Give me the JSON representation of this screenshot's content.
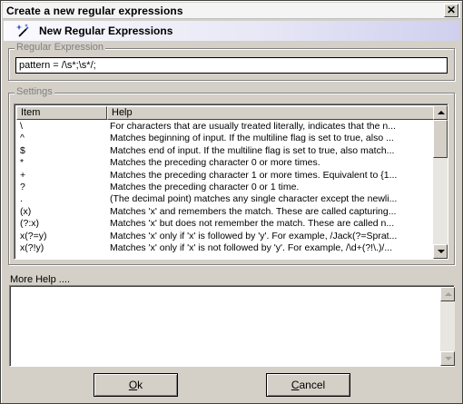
{
  "window": {
    "title": "Create a new regular expressions",
    "close_glyph": "✕",
    "header_title": "New Regular Expressions",
    "header_icon": "wand-icon"
  },
  "regex_group": {
    "legend": "Regular Expression",
    "value": "pattern = /\\s*;\\s*/;"
  },
  "settings": {
    "legend": "Settings",
    "columns": [
      "Item",
      "Help"
    ],
    "rows": [
      {
        "item": "\\",
        "help": "For characters that are usually treated literally, indicates that the n..."
      },
      {
        "item": "^",
        "help": "Matches beginning of input. If the multiline flag is set to true, also ..."
      },
      {
        "item": "$",
        "help": "Matches end of input. If the multiline flag is set to true, also match..."
      },
      {
        "item": "*",
        "help": "Matches the preceding character 0 or more times."
      },
      {
        "item": "+",
        "help": "Matches the preceding character 1 or more times. Equivalent to {1..."
      },
      {
        "item": "?",
        "help": "Matches the preceding character 0 or 1 time."
      },
      {
        "item": ".",
        "help": "(The decimal point) matches any single character except the newli..."
      },
      {
        "item": "(x)",
        "help": "Matches 'x' and remembers the match. These are called capturing..."
      },
      {
        "item": "(?:x)",
        "help": "Matches 'x' but does not remember the match. These are called n..."
      },
      {
        "item": "x(?=y)",
        "help": "Matches 'x' only if 'x' is followed by 'y'. For example, /Jack(?=Sprat..."
      },
      {
        "item": "x(?!y)",
        "help": "Matches 'x' only if 'x' is not followed by 'y'. For example, /\\d+(?!\\.)/..."
      },
      {
        "item": "",
        "help": ""
      }
    ]
  },
  "more_help": {
    "label": "More Help ....",
    "value": ""
  },
  "buttons": {
    "ok": {
      "accel": "O",
      "rest": "k"
    },
    "cancel": {
      "accel": "C",
      "rest": "ancel"
    }
  },
  "colors": {
    "face": "#d4d0c8",
    "header_gradient_end": "#cfd0ee"
  }
}
